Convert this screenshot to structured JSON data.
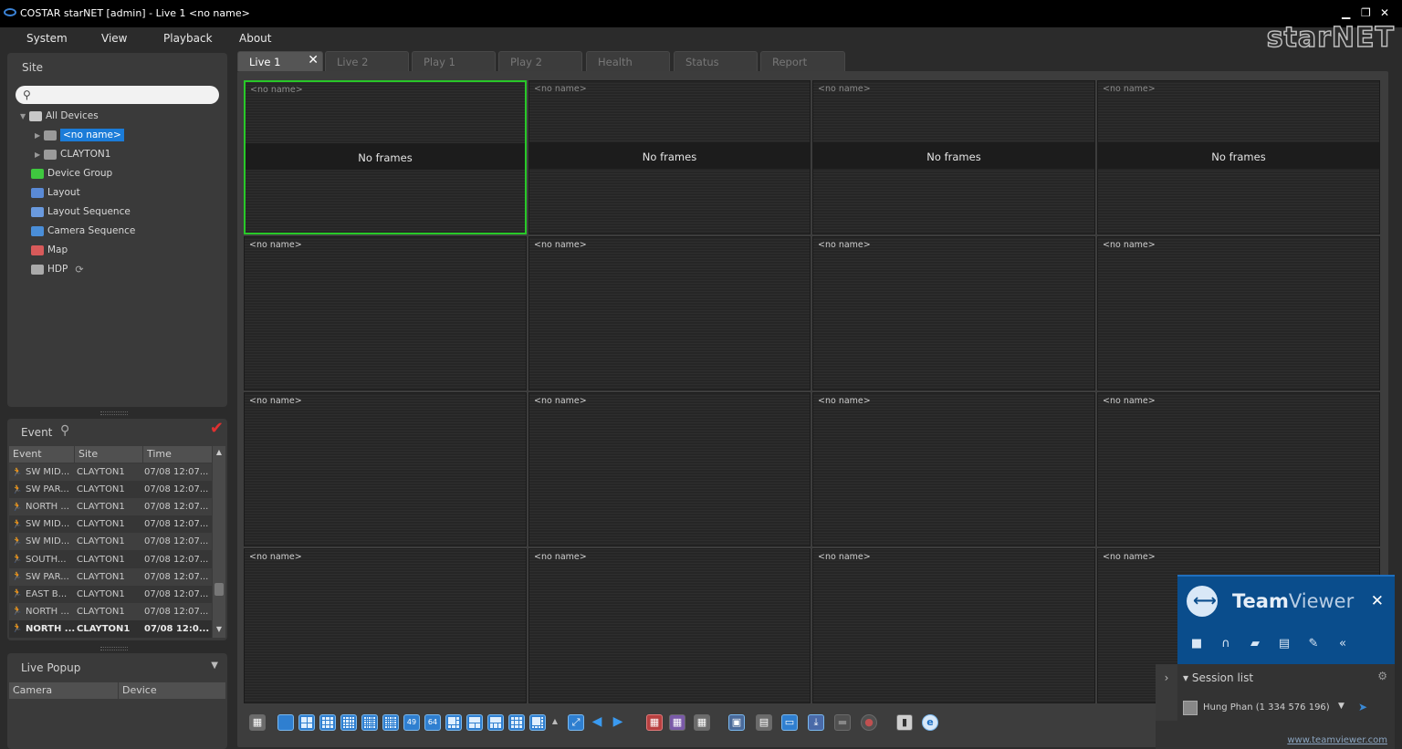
{
  "window": {
    "title": "COSTAR starNET [admin] - Live 1  <no name>",
    "minimize": "▁",
    "restore": "❐",
    "close": "✕"
  },
  "menu": [
    "System",
    "View",
    "Playback",
    "About"
  ],
  "logo": "starNET",
  "site_panel": {
    "title": "Site",
    "search_placeholder": "",
    "tree": [
      {
        "label": "All Devices",
        "icon": "devices-icon"
      },
      {
        "label": "<no name>",
        "icon": "dvr-icon",
        "selected": true
      },
      {
        "label": "CLAYTON1",
        "icon": "dvr-icon"
      },
      {
        "label": "Device Group",
        "icon": "device-group-icon"
      },
      {
        "label": "Layout",
        "icon": "layout-icon"
      },
      {
        "label": "Layout Sequence",
        "icon": "layout-sequence-icon"
      },
      {
        "label": "Camera Sequence",
        "icon": "camera-sequence-icon"
      },
      {
        "label": "Map",
        "icon": "map-icon"
      },
      {
        "label": "HDP",
        "icon": "hdp-icon"
      }
    ]
  },
  "event_panel": {
    "title": "Event",
    "columns": [
      "Event",
      "Site",
      "Time"
    ],
    "rows": [
      {
        "event": "SW MID...",
        "site": "CLAYTON1",
        "time": "07/08 12:07..."
      },
      {
        "event": "SW PAR...",
        "site": "CLAYTON1",
        "time": "07/08 12:07..."
      },
      {
        "event": "NORTH ...",
        "site": "CLAYTON1",
        "time": "07/08 12:07..."
      },
      {
        "event": "SW MID...",
        "site": "CLAYTON1",
        "time": "07/08 12:07..."
      },
      {
        "event": "SW MID...",
        "site": "CLAYTON1",
        "time": "07/08 12:07..."
      },
      {
        "event": "SOUTH...",
        "site": "CLAYTON1",
        "time": "07/08 12:07..."
      },
      {
        "event": "SW PAR...",
        "site": "CLAYTON1",
        "time": "07/08 12:07..."
      },
      {
        "event": "EAST B...",
        "site": "CLAYTON1",
        "time": "07/08 12:07..."
      },
      {
        "event": "NORTH ...",
        "site": "CLAYTON1",
        "time": "07/08 12:07..."
      },
      {
        "event": "NORTH ...",
        "site": "CLAYTON1",
        "time": "07/08 12:0...",
        "bold": true
      }
    ]
  },
  "popup_panel": {
    "title": "Live Popup",
    "columns": [
      "Camera",
      "Device"
    ]
  },
  "tabs": [
    {
      "label": "Live 1",
      "active": true
    },
    {
      "label": "Live 2"
    },
    {
      "label": "Play 1"
    },
    {
      "label": "Play 2"
    },
    {
      "label": "Health"
    },
    {
      "label": "Status"
    },
    {
      "label": "Report"
    }
  ],
  "tab_close": "✕",
  "cells": {
    "camera_name": "<no name>",
    "no_frames_text": "No frames",
    "count": 16,
    "columns": 4,
    "selected_index": 0
  },
  "teamviewer": {
    "brand_bold": "Team",
    "brand_light": "Viewer",
    "close": "✕",
    "session_title": "Session list",
    "session_user": "Hung Phan (1 334 576 196)",
    "url": "www.teamviewer.com"
  },
  "colors": {
    "accent": "#1b7cd8",
    "selection": "#28c828",
    "teamviewer": "#0a4d8c",
    "alert": "#e03030"
  }
}
